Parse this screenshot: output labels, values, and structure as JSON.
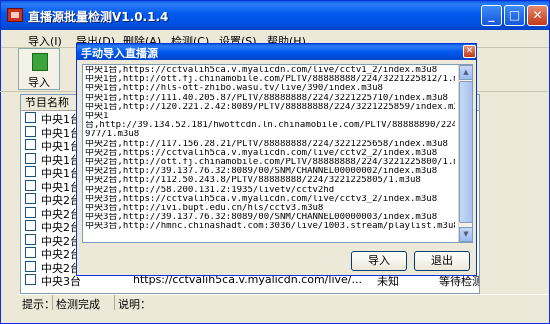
{
  "window": {
    "title": "直播源批量检测V1.0.1.4",
    "controls": {
      "minimize": "_",
      "maximize": "□",
      "close": "✕"
    }
  },
  "menu": [
    "导入(I)",
    "导出(D)",
    "删除(A)",
    "检测(C)",
    "设置(S)",
    "帮助(H)"
  ],
  "toolbar": {
    "import_label": "导入"
  },
  "list": {
    "header": "节目名称",
    "rows": [
      {
        "name": "中央1台"
      },
      {
        "name": "中央1台"
      },
      {
        "name": "中央1台"
      },
      {
        "name": "中央1台"
      },
      {
        "name": "中央1台"
      },
      {
        "name": "中央1台"
      },
      {
        "name": "中央2台"
      },
      {
        "name": "中央2台"
      },
      {
        "name": "中央2台"
      },
      {
        "name": "中央2台"
      },
      {
        "name": "中央2台"
      },
      {
        "name": "中央2台"
      },
      {
        "name": "中央3台"
      }
    ],
    "last_row": {
      "url": "https://cctvalih5ca.v.myalicdn.com/live/...",
      "status": "未知",
      "state": "等待检测"
    }
  },
  "status_bar": {
    "hint_label": "提示：",
    "hint_value": "检测完成",
    "desc_label": "说明："
  },
  "dialog": {
    "title": "手动导入直播源",
    "close": "✕",
    "lines": [
      "中央1台,https://cctvalih5ca.v.myalicdn.com/live/cctv1_2/index.m3u8",
      "中央1台,http://ott.fj.chinamobile.com/PLTV/88888888/224/3221225812/1.m3u8",
      "中央1台,http://hls-ott-zhibo.wasu.tv/live/390/index.m3u8",
      "中央1台,http://111.40.205.87/PLTV/88888888/224/3221225710/index.m3u8",
      "中央1台,http://120.221.2.42:8089/PLTV/88888888/224/3221225859/index.m3u8",
      "中央1",
      "台,http://39.134.52.181/hwottcdn.ln.chinamobile.com/PLTV/88888890/224/3221225",
      "977/1.m3u8",
      "中央2台,http://117.156.28.21/PLTV/88888888/224/3221225658/index.m3u8",
      "中央2台,https://cctvalih5ca.v.myalicdn.com/live/cctv2_2/index.m3u8",
      "中央2台,http://ott.fj.chinamobile.com/PLTV/88888888/224/3221225800/1.m3u8",
      "中央2台,http://39.137.76.32:8089/00/SNM/CHANNEL00000002/index.m3u8",
      "中央2台,http://112.50.243.8/PLTV/88888888/224/3221225805/1.m3u8",
      "中央2台,http://58.200.131.2:1935/livetv/cctv2hd",
      "中央3台,https://cctvalih5ca.v.myalicdn.com/live/cctv3_2/index.m3u8",
      "中央3台,http://ivi.bupt.edu.cn/hls/cctv3.m3u8",
      "中央3台,http://39.137.76.32:8089/00/SNM/CHANNEL00000003/index.m3u8",
      "中央3台,http://hmnc.chinashadt.com:3036/live/1003.stream/playlist.m3u8"
    ],
    "import_button": "导入",
    "exit_button": "退出"
  }
}
